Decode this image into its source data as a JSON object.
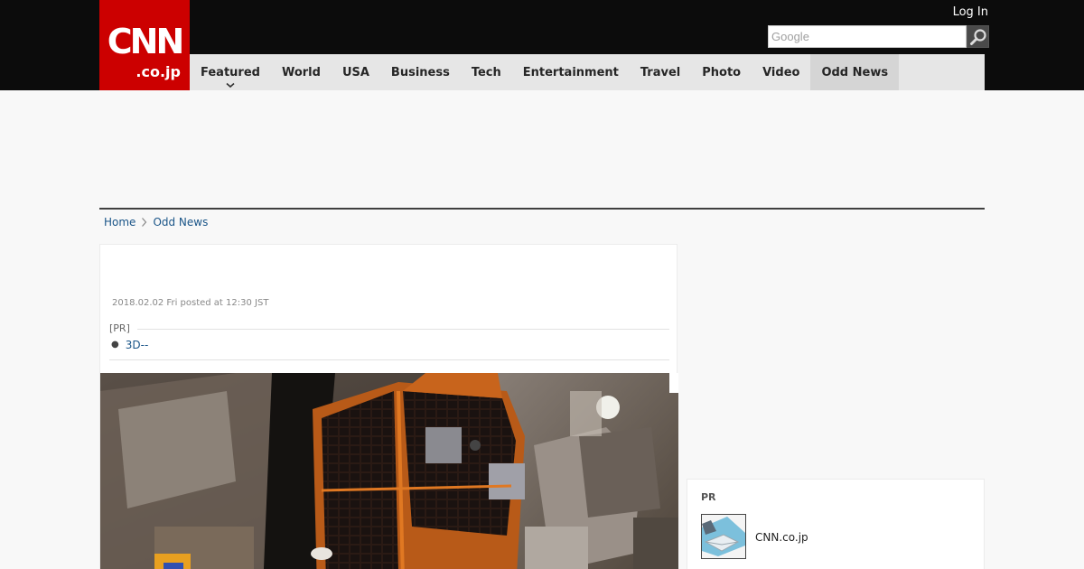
{
  "header": {
    "logo_main": "CNN",
    "logo_sub": ".co.jp",
    "login_label": "Log In",
    "search_placeholder": "Google"
  },
  "nav": {
    "items": [
      {
        "label": "Featured",
        "has_dropdown": true
      },
      {
        "label": "World"
      },
      {
        "label": "USA"
      },
      {
        "label": "Business"
      },
      {
        "label": "Tech"
      },
      {
        "label": "Entertainment"
      },
      {
        "label": "Travel"
      },
      {
        "label": "Photo"
      },
      {
        "label": "Video"
      },
      {
        "label": "Odd News",
        "active": true
      }
    ]
  },
  "breadcrumb": {
    "home": "Home",
    "current": "Odd News"
  },
  "article": {
    "posted": "2018.02.02 Fri posted at 12:30 JST",
    "pr_label": "[PR]",
    "pr_link": "3D--",
    "photo_icon": "satellite-photo"
  },
  "sidebar": {
    "pr_title": "PR",
    "pr_name": "CNN.co.jp",
    "pr_icon": "mail-thumbnail-icon"
  },
  "colors": {
    "brand_red": "#cc0000",
    "header_bg": "#0c0c0c",
    "nav_bg": "#e6e6e6",
    "link": "#1a5588"
  }
}
